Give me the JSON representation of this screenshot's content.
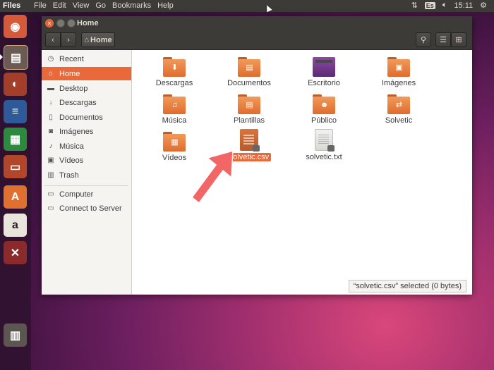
{
  "panel": {
    "app_name": "Files",
    "menu": [
      "File",
      "Edit",
      "View",
      "Go",
      "Bookmarks",
      "Help"
    ],
    "keyboard_layout": "Es",
    "clock": "15:11"
  },
  "launcher": {
    "apps": [
      "ubuntu-dash-icon",
      "files-icon",
      "firefox-icon",
      "writer-icon",
      "calc-icon",
      "impress-icon",
      "software-center-icon",
      "amazon-icon",
      "system-settings-icon",
      "trash-icon"
    ]
  },
  "window": {
    "title": "Home",
    "location": "Home"
  },
  "sidebar": {
    "places": [
      {
        "label": "Recent",
        "icon": "clock-icon",
        "active": false
      },
      {
        "label": "Home",
        "icon": "home-icon",
        "active": true
      },
      {
        "label": "Desktop",
        "icon": "folder-icon",
        "active": false
      },
      {
        "label": "Descargas",
        "icon": "download-icon",
        "active": false
      },
      {
        "label": "Documentos",
        "icon": "document-icon",
        "active": false
      },
      {
        "label": "Imágenes",
        "icon": "camera-icon",
        "active": false
      },
      {
        "label": "Música",
        "icon": "music-note-icon",
        "active": false
      },
      {
        "label": "Vídeos",
        "icon": "film-icon",
        "active": false
      },
      {
        "label": "Trash",
        "icon": "trash-icon",
        "active": false
      }
    ],
    "devices": [
      {
        "label": "Computer",
        "icon": "computer-icon"
      },
      {
        "label": "Connect to Server",
        "icon": "server-icon"
      }
    ]
  },
  "files": [
    {
      "name": "Descargas",
      "kind": "folder",
      "glyph": "download-icon"
    },
    {
      "name": "Documentos",
      "kind": "folder",
      "glyph": "document-icon"
    },
    {
      "name": "Escritorio",
      "kind": "desktop",
      "glyph": "desktop-icon"
    },
    {
      "name": "Imágenes",
      "kind": "folder",
      "glyph": "camera-icon"
    },
    {
      "name": "Música",
      "kind": "folder",
      "glyph": "music-note-icon"
    },
    {
      "name": "Plantillas",
      "kind": "folder",
      "glyph": "document-icon"
    },
    {
      "name": "Público",
      "kind": "folder",
      "glyph": "person-icon"
    },
    {
      "name": "Solvetic",
      "kind": "folder",
      "glyph": "share-icon"
    },
    {
      "name": "Vídeos",
      "kind": "folder",
      "glyph": "film-icon"
    },
    {
      "name": "solvetic.csv",
      "kind": "csv",
      "glyph": "spreadsheet-icon",
      "selected": true
    },
    {
      "name": "solvetic.txt",
      "kind": "txt",
      "glyph": "text-file-icon"
    }
  ],
  "status": "“solvetic.csv” selected  (0 bytes)",
  "colors": {
    "accent": "#e9693b",
    "panel": "#3c3b37",
    "folder": "#e6793a"
  }
}
